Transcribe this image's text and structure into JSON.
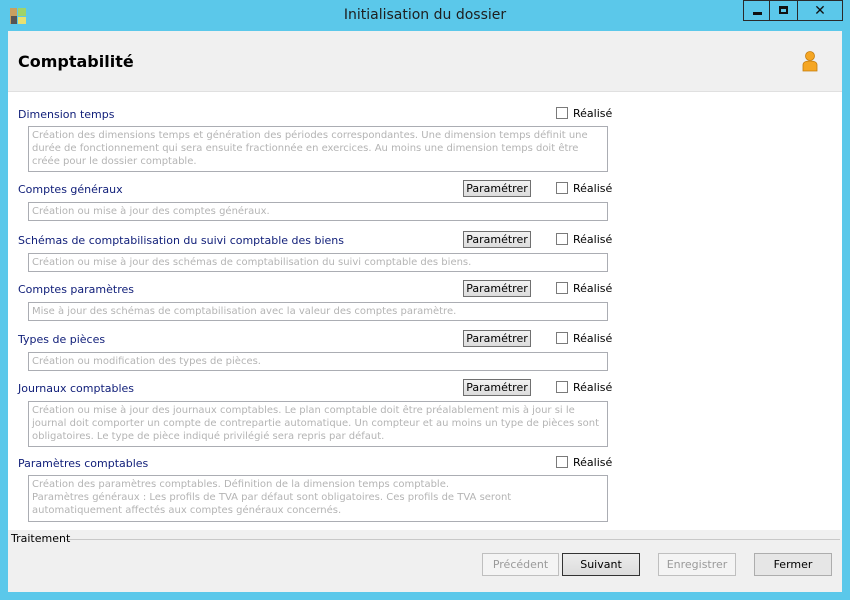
{
  "window": {
    "title": "Initialisation du dossier",
    "close_glyph": "✕"
  },
  "page": {
    "title": "Comptabilité",
    "user_icon": "person-icon"
  },
  "sections": [
    {
      "label": "Dimension temps",
      "has_param_button": false,
      "checkbox_label": "Réalisé",
      "checked": false,
      "description": "Création des dimensions temps et génération des périodes correspondantes. Une dimension temps définit une durée de fonctionnement qui sera ensuite fractionnée en exercices. Au moins une dimension temps doit être créée pour le dossier comptable."
    },
    {
      "label": "Comptes généraux",
      "has_param_button": true,
      "param_label": "Paramétrer",
      "checkbox_label": "Réalisé",
      "checked": false,
      "description": "Création ou mise à jour des comptes généraux."
    },
    {
      "label": "Schémas de comptabilisation du suivi comptable des biens",
      "has_param_button": true,
      "param_label": "Paramétrer",
      "checkbox_label": "Réalisé",
      "checked": false,
      "description": "Création ou mise à jour des schémas de comptabilisation du suivi comptable des biens."
    },
    {
      "label": "Comptes paramètres",
      "has_param_button": true,
      "param_label": "Paramétrer",
      "checkbox_label": "Réalisé",
      "checked": false,
      "description": "Mise à jour des schémas de comptabilisation avec la valeur des comptes paramètre."
    },
    {
      "label": "Types de pièces",
      "has_param_button": true,
      "param_label": "Paramétrer",
      "checkbox_label": "Réalisé",
      "checked": false,
      "description": "Création ou modification des types de pièces."
    },
    {
      "label": "Journaux comptables",
      "has_param_button": true,
      "param_label": "Paramétrer",
      "checkbox_label": "Réalisé",
      "checked": false,
      "description": "Création ou mise à jour des journaux comptables. Le plan comptable doit être préalablement mis à jour si le journal doit comporter un compte de contrepartie automatique. Un compteur et au moins un type de pièces sont obligatoires. Le type de pièce indiqué privilégié sera repris par défaut."
    },
    {
      "label": "Paramètres comptables",
      "has_param_button": false,
      "checkbox_label": "Réalisé",
      "checked": false,
      "description": "Création des paramètres comptables. Définition de la dimension temps comptable.\nParamètres généraux : Les profils de TVA par défaut sont obligatoires. Ces profils de TVA seront automatiquement affectés aux comptes généraux concernés."
    }
  ],
  "footer": {
    "group_label": "Traitement",
    "buttons": {
      "previous": "Précédent",
      "next": "Suivant",
      "save": "Enregistrer",
      "close": "Fermer"
    }
  }
}
